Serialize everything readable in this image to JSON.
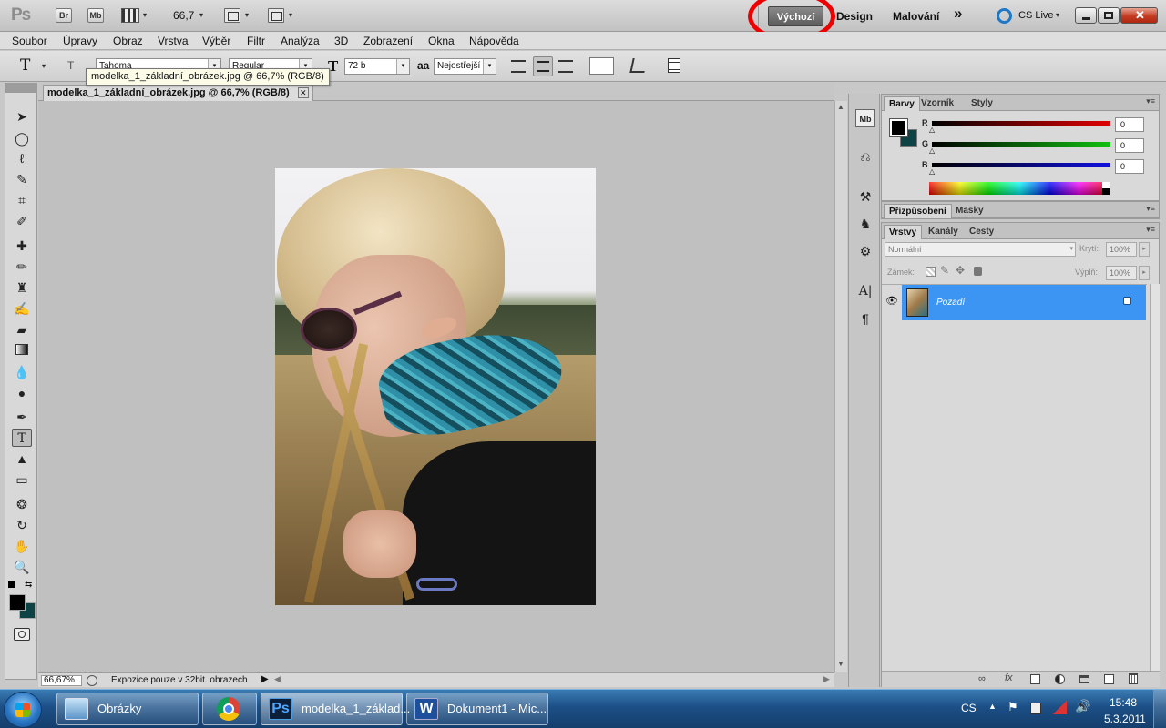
{
  "app": {
    "logo": "Ps",
    "bridge_label": "Br",
    "minibridge_label": "Mb",
    "zoom_value": "66,7",
    "dropdown_glyph": "▾",
    "workspaces": [
      "Výchozí",
      "Design",
      "Malování"
    ],
    "overflow_glyph": "»",
    "cs_live": "CS Live",
    "annotation_color": "#ee0000"
  },
  "menu": [
    "Soubor",
    "Úpravy",
    "Obraz",
    "Vrstva",
    "Výběr",
    "Filtr",
    "Analýza",
    "3D",
    "Zobrazení",
    "Okna",
    "Nápověda"
  ],
  "options": {
    "tool_glyph": "T",
    "font_family": "Tahoma",
    "font_style": "Regular",
    "font_size": "72 b",
    "aa_label": "aa",
    "antialias": "Nejostřejší"
  },
  "document": {
    "tooltip": "modelka_1_základní_obrázek.jpg @ 66,7% (RGB/8)",
    "tab_title": "modelka_1_základní_obrázek.jpg @ 66,7% (RGB/8)",
    "close_glyph": "✕",
    "zoom": "66,67%",
    "status_text": "Expozice pouze v 32bit. obrazech"
  },
  "panels": {
    "color": {
      "tabs": [
        "Barvy",
        "Vzorník",
        "Styly"
      ],
      "channels": [
        {
          "label": "R",
          "value": "0",
          "color": "#e00000"
        },
        {
          "label": "G",
          "value": "0",
          "color": "#10c010"
        },
        {
          "label": "B",
          "value": "0",
          "color": "#1010e0"
        }
      ]
    },
    "adjust": {
      "tabs": [
        "Přizpůsobení",
        "Masky"
      ]
    },
    "layers": {
      "tabs": [
        "Vrstvy",
        "Kanály",
        "Cesty"
      ],
      "blend_mode": "Normální",
      "opacity_label": "Krytí:",
      "opacity_value": "100%",
      "lock_label": "Zámek:",
      "fill_label": "Výplň:",
      "fill_value": "100%",
      "layer_name": "Pozadí",
      "selected_color": "#3c95f2"
    }
  },
  "taskbar": {
    "items": [
      "Obrázky",
      "",
      "modelka_1_základ...",
      "Dokument1 - Mic..."
    ],
    "language": "CS",
    "time": "15:48",
    "date": "5.3.2011"
  }
}
